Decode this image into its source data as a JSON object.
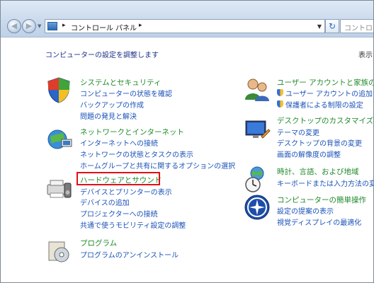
{
  "window": {
    "address": {
      "crumb": "コントロール パネル",
      "sep": "▸"
    },
    "search_placeholder": "コントロール",
    "nav": {
      "back_glyph": "◀",
      "forward_glyph": "▶",
      "dropdown_glyph": "▼",
      "refresh_glyph": "↻"
    }
  },
  "content": {
    "heading": "コンピューターの設定を調整します",
    "view_by": "表示"
  },
  "categories_left": [
    {
      "icon": "system-security-icon",
      "title": "システムとセキュリティ",
      "links": [
        "コンピューターの状態を確認",
        "バックアップの作成",
        "問題の発見と解決"
      ]
    },
    {
      "icon": "network-internet-icon",
      "title": "ネットワークとインターネット",
      "links": [
        "インターネットへの接続",
        "ネットワークの状態とタスクの表示",
        "ホームグループと共有に関するオプションの選択"
      ]
    },
    {
      "icon": "hardware-sound-icon",
      "title": "ハードウェアとサウンド",
      "links": [
        "デバイスとプリンターの表示",
        "デバイスの追加",
        "プロジェクターへの接続",
        "共通で使うモビリティ設定の調整"
      ]
    },
    {
      "icon": "programs-icon",
      "title": "プログラム",
      "links": [
        "プログラムのアンインストール"
      ]
    }
  ],
  "categories_right": [
    {
      "icon": "user-accounts-icon",
      "title": "ユーザー アカウントと家族のた",
      "links": [
        "ユーザー アカウントの追加ま",
        "保護者による制限の設定"
      ]
    },
    {
      "icon": "appearance-personalization-icon",
      "title": "デスクトップのカスタマイズ",
      "links": [
        "テーマの変更",
        "デスクトップの背景の変更",
        "画面の解像度の調整"
      ]
    },
    {
      "icon": "clock-region-icon",
      "title": "時計、言語、および地域",
      "links": [
        "キーボードまたは入力方法の変"
      ]
    },
    {
      "icon": "ease-of-access-icon",
      "title": "コンピューターの簡単操作",
      "links": [
        "設定の提案の表示",
        "視覚ディスプレイの最適化"
      ]
    }
  ],
  "annotation": {
    "highlight_color": "#e0101a",
    "highlight_target": "ハードウェアとサウンド"
  },
  "colors": {
    "category_title": "#1f8a2a",
    "link": "#1a52b8",
    "heading": "#1e3287"
  }
}
